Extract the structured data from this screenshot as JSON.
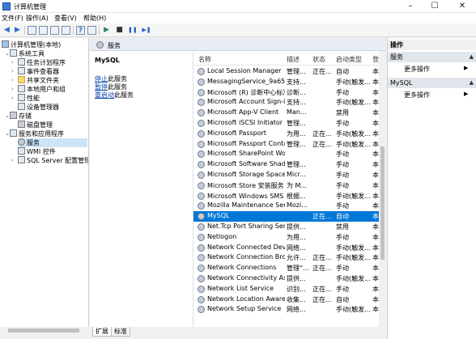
{
  "window": {
    "title": "计算机管理",
    "controls": {
      "minimize": "–",
      "maximize": "☐",
      "close": "✕"
    }
  },
  "menu": [
    "文件(F)",
    "操作(A)",
    "查看(V)",
    "帮助(H)"
  ],
  "toolbar_icons": [
    {
      "name": "back-icon",
      "glyph": "◀"
    },
    {
      "name": "forward-icon",
      "glyph": "▶"
    },
    {
      "name": "up-folder-icon",
      "glyph": ""
    },
    {
      "name": "show-hide-tree-icon",
      "glyph": ""
    },
    {
      "name": "refresh-icon",
      "glyph": ""
    },
    {
      "name": "export-list-icon",
      "glyph": ""
    },
    {
      "name": "help-icon",
      "glyph": "?"
    },
    {
      "name": "properties-icon",
      "glyph": ""
    },
    {
      "name": "start-service-icon",
      "glyph": "▶"
    },
    {
      "name": "stop-service-icon",
      "glyph": "■"
    },
    {
      "name": "pause-service-icon",
      "glyph": "❚❚"
    },
    {
      "name": "restart-service-icon",
      "glyph": "▶❚"
    }
  ],
  "tree": {
    "root": "计算机管理(本地)",
    "system_tools": "系统工具",
    "task_scheduler": "任务计划程序",
    "event_viewer": "事件查看器",
    "shared_folders": "共享文件夹",
    "local_users": "本地用户和组",
    "performance": "性能",
    "device_manager": "设备管理器",
    "storage": "存储",
    "disk_management": "磁盘管理",
    "services_apps": "服务和应用程序",
    "services": "服务",
    "wmi": "WMI 控件",
    "sql_config": "SQL Server 配置管理器"
  },
  "center": {
    "header_title": "服务",
    "selected_service": "MySQL",
    "actions": [
      {
        "link": "停止",
        "rest": "此服务"
      },
      {
        "link": "暂停",
        "rest": "此服务"
      },
      {
        "link": "重启动",
        "rest": "此服务"
      }
    ]
  },
  "list": {
    "columns": {
      "name": "名称",
      "desc": "描述",
      "status": "状态",
      "startup": "启动类型",
      "logon": "登"
    },
    "rows": [
      {
        "name": "Local Session Manager",
        "desc": "管理...",
        "status": "正在...",
        "startup": "自动",
        "logon": "本"
      },
      {
        "name": "MessagingService_9a65e99",
        "desc": "支持...",
        "status": "",
        "startup": "手动(触发...",
        "logon": "本"
      },
      {
        "name": "Microsoft (R) 诊断中心标准...",
        "desc": "诊断...",
        "status": "",
        "startup": "手动",
        "logon": "本"
      },
      {
        "name": "Microsoft Account Sign-in ...",
        "desc": "支持...",
        "status": "",
        "startup": "手动(触发...",
        "logon": "本"
      },
      {
        "name": "Microsoft App-V Client",
        "desc": "Man...",
        "status": "",
        "startup": "禁用",
        "logon": "本"
      },
      {
        "name": "Microsoft iSCSI Initiator Ser...",
        "desc": "管理...",
        "status": "",
        "startup": "手动",
        "logon": "本"
      },
      {
        "name": "Microsoft Passport",
        "desc": "为用...",
        "status": "正在...",
        "startup": "手动(触发...",
        "logon": "本"
      },
      {
        "name": "Microsoft Passport Container",
        "desc": "管理...",
        "status": "正在...",
        "startup": "手动(触发...",
        "logon": "本"
      },
      {
        "name": "Microsoft SharePoint Work...",
        "desc": "",
        "status": "",
        "startup": "手动",
        "logon": "本"
      },
      {
        "name": "Microsoft Software Shado...",
        "desc": "管理...",
        "status": "",
        "startup": "手动",
        "logon": "本"
      },
      {
        "name": "Microsoft Storage Spaces S...",
        "desc": "Micr...",
        "status": "",
        "startup": "手动",
        "logon": "本"
      },
      {
        "name": "Microsoft Store 安装服务",
        "desc": "为 M...",
        "status": "",
        "startup": "手动",
        "logon": "本"
      },
      {
        "name": "Microsoft Windows SMS 路...",
        "desc": "根据...",
        "status": "",
        "startup": "手动(触发...",
        "logon": "本"
      },
      {
        "name": "Mozilla Maintenance Service",
        "desc": "Mozi...",
        "status": "",
        "startup": "手动",
        "logon": "本"
      },
      {
        "name": "MySQL",
        "desc": "",
        "status": "正在...",
        "startup": "自动",
        "logon": "本"
      },
      {
        "name": "Net.Tcp Port Sharing Service",
        "desc": "提供...",
        "status": "",
        "startup": "禁用",
        "logon": "本"
      },
      {
        "name": "Netlogon",
        "desc": "为用...",
        "status": "",
        "startup": "手动",
        "logon": "本"
      },
      {
        "name": "Network Connected Devic...",
        "desc": "网络...",
        "status": "",
        "startup": "手动(触发...",
        "logon": "本"
      },
      {
        "name": "Network Connection Broker",
        "desc": "允许...",
        "status": "正在...",
        "startup": "手动(触发...",
        "logon": "本"
      },
      {
        "name": "Network Connections",
        "desc": "管理“...",
        "status": "正在...",
        "startup": "手动",
        "logon": "本"
      },
      {
        "name": "Network Connectivity Assis...",
        "desc": "提供...",
        "status": "",
        "startup": "手动(触发...",
        "logon": "本"
      },
      {
        "name": "Network List Service",
        "desc": "识别...",
        "status": "正在...",
        "startup": "手动",
        "logon": "本"
      },
      {
        "name": "Network Location Awarene",
        "desc": "收集...",
        "status": "正在...",
        "startup": "自动",
        "logon": "本"
      },
      {
        "name": "Network Setup Service",
        "desc": "网络...",
        "status": "",
        "startup": "手动(触发...",
        "logon": "本"
      }
    ]
  },
  "tabs": [
    "扩展",
    "标准"
  ],
  "actions_pane": {
    "title": "操作",
    "group1": "服务",
    "more1": "更多操作",
    "group2": "MySQL",
    "more2": "更多操作"
  }
}
